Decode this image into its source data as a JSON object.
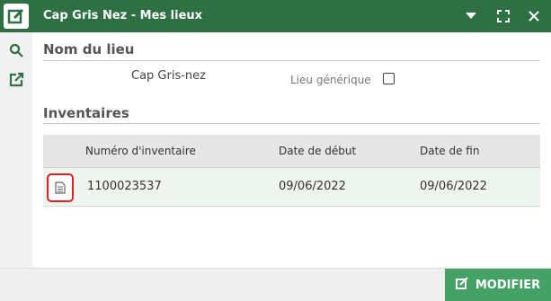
{
  "window": {
    "title": "Cap Gris Nez - Mes lieux",
    "title_bar_color": "#2f6f44"
  },
  "sidebar": {
    "icons": [
      "search-icon",
      "open-external-icon"
    ]
  },
  "place_section": {
    "heading": "Nom du lieu",
    "place_name": "Cap Gris-nez",
    "generic_label": "Lieu générique",
    "generic_checked": false
  },
  "inventories": {
    "heading": "Inventaires",
    "columns": [
      "Numéro d'inventaire",
      "Date de début",
      "Date de fin"
    ],
    "rows": [
      {
        "number": "1100023537",
        "start": "09/06/2022",
        "end": "09/06/2022"
      }
    ]
  },
  "footer": {
    "modify_label": "MODIFIER",
    "accent": "#44a267"
  }
}
